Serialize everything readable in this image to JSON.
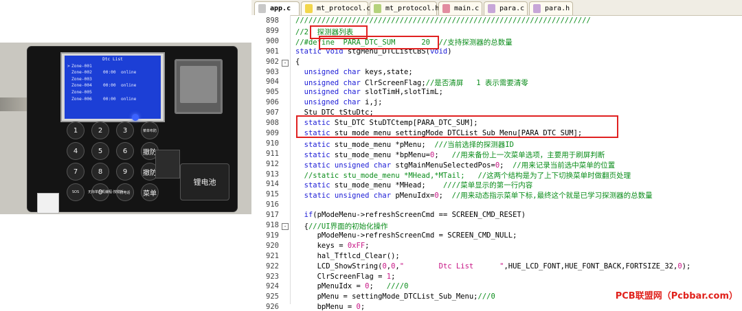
{
  "photo": {
    "lcd": {
      "title": "Dtc List",
      "rows": [
        {
          "mark": ">",
          "zone": "Zone-001",
          "time": "",
          "status": ""
        },
        {
          "mark": "",
          "zone": "Zone-002",
          "time": "00:00",
          "status": "online"
        },
        {
          "mark": "",
          "zone": "Zone-003",
          "time": "",
          "status": ""
        },
        {
          "mark": "",
          "zone": "Zone-004",
          "time": "00:00",
          "status": "online"
        },
        {
          "mark": "",
          "zone": "Zone-005",
          "time": "",
          "status": ""
        },
        {
          "mark": "",
          "zone": "Zone-006",
          "time": "00:00",
          "status": "online"
        }
      ]
    },
    "keys": [
      "1",
      "2",
      "3",
      "菜单布防",
      "4",
      "5",
      "6",
      "撤防",
      "7",
      "8",
      "9",
      "撤防",
      "SOS",
      "0",
      "打电话",
      "菜单"
    ],
    "board_label": "无际单片机编程-按键板",
    "battery": "锂电池"
  },
  "tabs": [
    {
      "label": "app.c",
      "color": "#c8c8c8",
      "active": true
    },
    {
      "label": "mt_protocol.c",
      "color": "#f2d64b",
      "active": false
    },
    {
      "label": "mt_protocol.h",
      "color": "#b5d27c",
      "active": false
    },
    {
      "label": "main.c",
      "color": "#e28ca0",
      "active": false
    },
    {
      "label": "para.c",
      "color": "#c7a6d8",
      "active": false
    },
    {
      "label": "para.h",
      "color": "#c7a6d8",
      "active": false
    }
  ],
  "lines": [
    {
      "n": "898",
      "fold": "",
      "tokens": [
        {
          "t": "////////////////////////////////////////////////////////////////////",
          "c": "cm"
        }
      ]
    },
    {
      "n": "899",
      "fold": "",
      "tokens": [
        {
          "t": "//2.",
          "c": "cm"
        },
        {
          "t": " 探测器列表",
          "c": "cm"
        }
      ]
    },
    {
      "n": "900",
      "fold": "",
      "tokens": [
        {
          "t": "//#define  PARA_DTC_SUM      20  //支持探测器的总数量",
          "c": "cm"
        }
      ]
    },
    {
      "n": "901",
      "fold": "",
      "tokens": [
        {
          "t": "static void ",
          "c": "kw"
        },
        {
          "t": "stgMenu_DTCListCBS(",
          "c": ""
        },
        {
          "t": "void",
          "c": "kw"
        },
        {
          "t": ")",
          "c": ""
        }
      ]
    },
    {
      "n": "902",
      "fold": "-",
      "tokens": [
        {
          "t": "{",
          "c": ""
        }
      ]
    },
    {
      "n": "903",
      "fold": "",
      "tokens": [
        {
          "t": "  unsigned char ",
          "c": "kw"
        },
        {
          "t": "keys,state;",
          "c": ""
        }
      ]
    },
    {
      "n": "904",
      "fold": "",
      "tokens": [
        {
          "t": "  unsigned char ",
          "c": "kw"
        },
        {
          "t": "ClrScreenFlag;",
          "c": ""
        },
        {
          "t": "//是否清屏   1 表示需要清零",
          "c": "cm"
        }
      ]
    },
    {
      "n": "905",
      "fold": "",
      "tokens": [
        {
          "t": "  unsigned char ",
          "c": "kw"
        },
        {
          "t": "slotTimH,slotTimL;",
          "c": ""
        }
      ]
    },
    {
      "n": "906",
      "fold": "",
      "tokens": [
        {
          "t": "  unsigned char ",
          "c": "kw"
        },
        {
          "t": "i,j;",
          "c": ""
        }
      ]
    },
    {
      "n": "907",
      "fold": "",
      "tokens": [
        {
          "t": "  Stu_DTC tStuDtc;",
          "c": ""
        }
      ]
    },
    {
      "n": "908",
      "fold": "",
      "tokens": [
        {
          "t": "  static ",
          "c": "kw"
        },
        {
          "t": "Stu_DTC StuDTCtemp[PARA_DTC_SUM];",
          "c": ""
        }
      ]
    },
    {
      "n": "909",
      "fold": "",
      "tokens": [
        {
          "t": "  static ",
          "c": "kw"
        },
        {
          "t": "stu_mode_menu settingMode_DTCList_Sub_Menu[PARA_DTC_SUM];",
          "c": ""
        }
      ]
    },
    {
      "n": "910",
      "fold": "",
      "tokens": [
        {
          "t": "  static ",
          "c": "kw"
        },
        {
          "t": "stu_mode_menu *pMenu;  ",
          "c": ""
        },
        {
          "t": "///当前选择的探测器ID",
          "c": "cm"
        }
      ]
    },
    {
      "n": "911",
      "fold": "",
      "tokens": [
        {
          "t": "  static ",
          "c": "kw"
        },
        {
          "t": "stu_mode_menu *bpMenu=",
          "c": ""
        },
        {
          "t": "0",
          "c": "num"
        },
        {
          "t": ";   ",
          "c": ""
        },
        {
          "t": "//用来备份上一次菜单选项，主要用于刷屏判断",
          "c": "cm"
        }
      ]
    },
    {
      "n": "912",
      "fold": "",
      "tokens": [
        {
          "t": "  static unsigned char ",
          "c": "kw"
        },
        {
          "t": "stgMainMenuSelectedPos=",
          "c": ""
        },
        {
          "t": "0",
          "c": "num"
        },
        {
          "t": ";  ",
          "c": ""
        },
        {
          "t": "//用来记录当前选中菜单的位置",
          "c": "cm"
        }
      ]
    },
    {
      "n": "913",
      "fold": "",
      "tokens": [
        {
          "t": "  //static stu_mode_menu *MHead,*MTail;   //这两个结构是为了上下切换菜单时做翻页处理",
          "c": "cm"
        }
      ]
    },
    {
      "n": "914",
      "fold": "",
      "tokens": [
        {
          "t": "  static ",
          "c": "kw"
        },
        {
          "t": "stu_mode_menu *MHead;    ",
          "c": ""
        },
        {
          "t": "////菜单显示的第一行内容",
          "c": "cm"
        }
      ]
    },
    {
      "n": "915",
      "fold": "",
      "tokens": [
        {
          "t": "  static unsigned char ",
          "c": "kw"
        },
        {
          "t": "pMenuIdx=",
          "c": ""
        },
        {
          "t": "0",
          "c": "num"
        },
        {
          "t": ";  ",
          "c": ""
        },
        {
          "t": "//用来动态指示菜单下标,最终这个就是已学习探测器的总数量",
          "c": "cm"
        }
      ]
    },
    {
      "n": "916",
      "fold": "",
      "tokens": [
        {
          "t": "",
          "c": ""
        }
      ]
    },
    {
      "n": "917",
      "fold": "",
      "tokens": [
        {
          "t": "  if",
          "c": "kw"
        },
        {
          "t": "(pModeMenu->refreshScreenCmd == SCREEN_CMD_RESET)",
          "c": ""
        }
      ]
    },
    {
      "n": "918",
      "fold": "-",
      "tokens": [
        {
          "t": "  {",
          "c": ""
        },
        {
          "t": "///UI界面的初始化操作",
          "c": "cm"
        }
      ]
    },
    {
      "n": "919",
      "fold": "",
      "tokens": [
        {
          "t": "     pModeMenu->refreshScreenCmd = SCREEN_CMD_NULL;",
          "c": ""
        }
      ]
    },
    {
      "n": "920",
      "fold": "",
      "tokens": [
        {
          "t": "     keys = ",
          "c": ""
        },
        {
          "t": "0xFF",
          "c": "num"
        },
        {
          "t": ";",
          "c": ""
        }
      ]
    },
    {
      "n": "921",
      "fold": "",
      "tokens": [
        {
          "t": "     hal_Tftlcd_Clear();",
          "c": ""
        }
      ]
    },
    {
      "n": "922",
      "fold": "",
      "tokens": [
        {
          "t": "     LCD_ShowString(",
          "c": ""
        },
        {
          "t": "0",
          "c": "num"
        },
        {
          "t": ",",
          "c": ""
        },
        {
          "t": "0",
          "c": "num"
        },
        {
          "t": ",",
          "c": ""
        },
        {
          "t": "\"        Dtc List      \"",
          "c": "num"
        },
        {
          "t": ",HUE_LCD_FONT,HUE_FONT_BACK,FORTSIZE_32,",
          "c": ""
        },
        {
          "t": "0",
          "c": "num"
        },
        {
          "t": ");",
          "c": ""
        }
      ]
    },
    {
      "n": "923",
      "fold": "",
      "tokens": [
        {
          "t": "     ClrScreenFlag = ",
          "c": ""
        },
        {
          "t": "1",
          "c": "num"
        },
        {
          "t": ";",
          "c": ""
        }
      ]
    },
    {
      "n": "924",
      "fold": "",
      "tokens": [
        {
          "t": "     pMenuIdx = ",
          "c": ""
        },
        {
          "t": "0",
          "c": "num"
        },
        {
          "t": ";   ",
          "c": ""
        },
        {
          "t": "////0",
          "c": "cm"
        }
      ]
    },
    {
      "n": "925",
      "fold": "",
      "tokens": [
        {
          "t": "     pMenu = settingMode_DTCList_Sub_Menu;",
          "c": ""
        },
        {
          "t": "///0",
          "c": "cm"
        }
      ]
    },
    {
      "n": "926",
      "fold": "",
      "tokens": [
        {
          "t": "     bpMenu = ",
          "c": ""
        },
        {
          "t": "0",
          "c": "num"
        },
        {
          "t": ";",
          "c": ""
        }
      ]
    }
  ],
  "watermark": "PCB联盟网（Pcbbar.com）"
}
